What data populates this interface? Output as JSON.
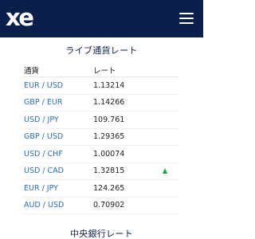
{
  "header": {
    "logo_text": "xe",
    "menu_icon": "hamburger-menu-icon",
    "background_color": "#0b1f4b"
  },
  "live_rates": {
    "title": "ライブ通貨レート",
    "columns": {
      "pair": "通貨",
      "rate": "レート"
    },
    "rows": [
      {
        "pair": "EUR / USD",
        "rate": "1.13214",
        "trend": ""
      },
      {
        "pair": "GBP / EUR",
        "rate": "1.14266",
        "trend": ""
      },
      {
        "pair": "USD / JPY",
        "rate": "109.761",
        "trend": ""
      },
      {
        "pair": "GBP / USD",
        "rate": "1.29365",
        "trend": ""
      },
      {
        "pair": "USD / CHF",
        "rate": "1.00074",
        "trend": ""
      },
      {
        "pair": "USD / CAD",
        "rate": "1.32815",
        "trend": "up"
      },
      {
        "pair": "EUR / JPY",
        "rate": "124.265",
        "trend": ""
      },
      {
        "pair": "AUD / USD",
        "rate": "0.70902",
        "trend": ""
      }
    ],
    "trend_up_color": "#18a33c",
    "pair_link_color": "#2f6db3"
  },
  "central_bank": {
    "title": "中央銀行レート"
  }
}
